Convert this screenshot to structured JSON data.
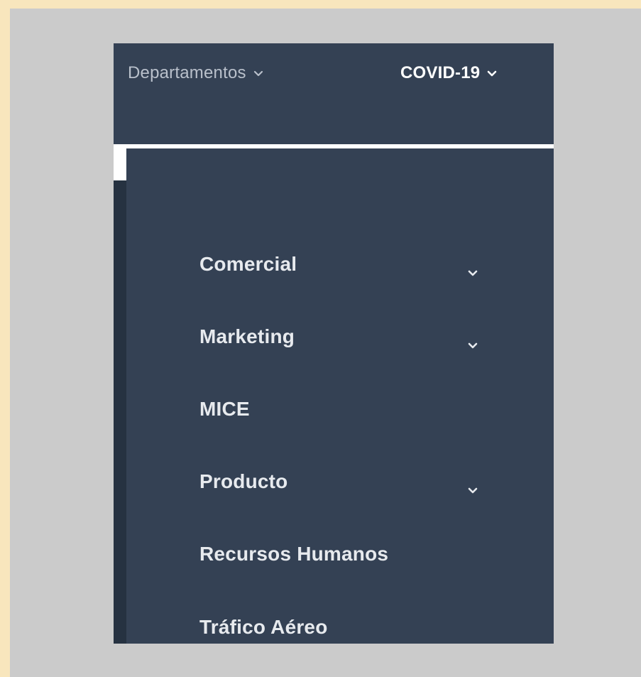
{
  "nav": {
    "items": [
      {
        "label": "Departamentos",
        "has_dropdown": true,
        "state": "open"
      },
      {
        "label": "COVID-19",
        "has_dropdown": true
      }
    ]
  },
  "dropdown": {
    "items": [
      {
        "label": "Comercial",
        "has_submenu": true
      },
      {
        "label": "Marketing",
        "has_submenu": true
      },
      {
        "label": "MICE",
        "has_submenu": false
      },
      {
        "label": "Producto",
        "has_submenu": true
      },
      {
        "label": "Recursos Humanos",
        "has_submenu": false
      },
      {
        "label": "Tráfico Aéreo",
        "has_submenu": false
      }
    ]
  },
  "icons": {
    "dropdown_indicator": "chevron-down-icon"
  },
  "colors": {
    "page_background": "#f8e6bd",
    "canvas_background": "#cbcbcb",
    "menu_background": "#344154",
    "menu_accent_bar": "#263241",
    "nav_text_muted": "#b9c0cb",
    "nav_text_active": "#ffffff",
    "dropdown_text": "#e7eaee"
  }
}
